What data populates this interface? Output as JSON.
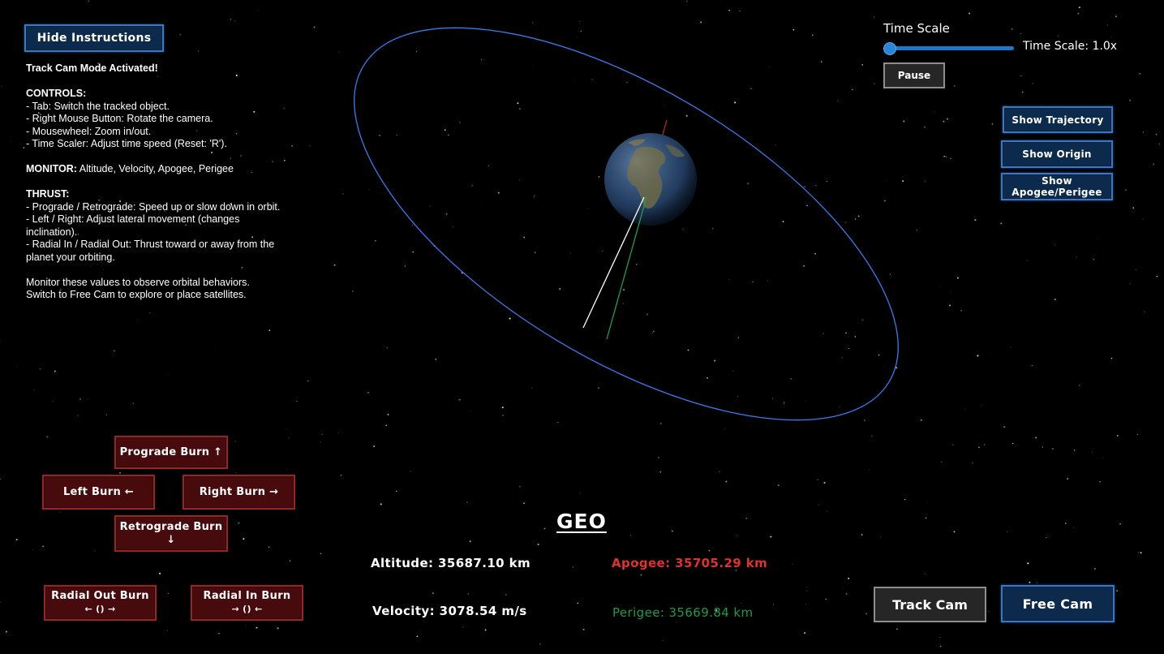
{
  "instructions_toggle": {
    "label": "Hide Instructions"
  },
  "instructions": {
    "lines": [
      {
        "text": "Track Cam Mode Activated!",
        "bold": true
      },
      {
        "text": ""
      },
      {
        "text": "CONTROLS:",
        "bold": true
      },
      {
        "text": "- Tab: Switch the tracked object."
      },
      {
        "text": "- Right Mouse Button: Rotate the camera."
      },
      {
        "text": "- Mousewheel: Zoom in/out."
      },
      {
        "text": "- Time Scaler: Adjust time speed (Reset: 'R')."
      },
      {
        "text": ""
      },
      {
        "label": "MONITOR:",
        "text": " Altitude, Velocity, Apogee, Perigee"
      },
      {
        "text": ""
      },
      {
        "text": "THRUST:",
        "bold": true
      },
      {
        "text": "- Prograde / Retrograde: Speed up or slow down in orbit."
      },
      {
        "text": "- Left / Right: Adjust lateral movement (changes"
      },
      {
        "text": "inclination)."
      },
      {
        "text": "- Radial In / Radial Out: Thrust toward or away from the"
      },
      {
        "text": "planet your orbiting."
      },
      {
        "text": ""
      },
      {
        "text": "Monitor these values to observe orbital behaviors."
      },
      {
        "text": "Switch to Free Cam to explore or place satellites."
      }
    ]
  },
  "time_scale": {
    "title": "Time Scale",
    "value_label": "Time Scale: 1.0x",
    "slider_fraction": 0.0,
    "pause_label": "Pause"
  },
  "toggles": {
    "trajectory": "Show Trajectory",
    "origin": "Show Origin",
    "apogee_perigee_line1": "Show",
    "apogee_perigee_line2": "Apogee/Perigee"
  },
  "burns": {
    "prograde": "Prograde Burn ↑",
    "left": "Left Burn ←",
    "right": "Right Burn →",
    "retrograde": "Retrograde Burn ↓",
    "radial_out_line1": "Radial Out Burn",
    "radial_out_line2": "← () →",
    "radial_in_line1": "Radial In Burn",
    "radial_in_line2": "→ () ←"
  },
  "orbit": {
    "name": "GEO",
    "altitude": "Altitude: 35687.10 km",
    "velocity": "Velocity: 3078.54 m/s",
    "apogee": "Apogee: 35705.29 km",
    "perigee": "Perigee: 35669.84 km"
  },
  "camera": {
    "track_label": "Track Cam",
    "free_label": "Free Cam"
  },
  "colors": {
    "background": "#000000",
    "orbit_line": "#3a7bf0",
    "apogee": "#e0322d",
    "perigee": "#1f9a4a",
    "button_blue": "#0c2a4c",
    "button_red": "#470a0d",
    "button_grey": "#262626"
  }
}
